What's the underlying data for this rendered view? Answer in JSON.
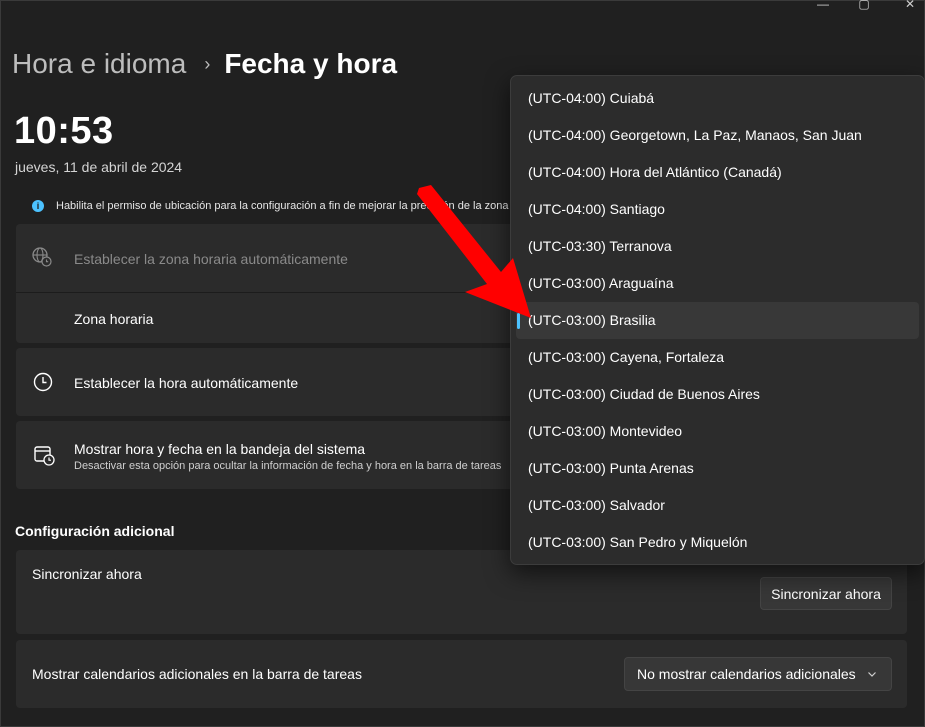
{
  "window": {
    "minimize": "—",
    "maximize": "▢",
    "close": "✕"
  },
  "breadcrumb": {
    "parent": "Hora e idioma",
    "separator": "›",
    "current": "Fecha y hora"
  },
  "clock": {
    "time": "10:53",
    "date": "jueves, 11 de abril de 2024"
  },
  "info_bar": {
    "icon": "info-icon",
    "text": "Habilita el permiso de ubicación para la configuración a fin de mejorar la precisión de la zona"
  },
  "settings": {
    "auto_timezone": {
      "label": "Establecer la zona horaria automáticamente",
      "icon": "globe-clock-icon",
      "disabled": true
    },
    "timezone": {
      "label": "Zona horaria"
    },
    "auto_time": {
      "label": "Establecer la hora automáticamente",
      "icon": "clock-icon"
    },
    "tray": {
      "label": "Mostrar hora y fecha en la bandeja del sistema",
      "description": "Desactivar esta opción para ocultar la información de fecha y hora en la barra de tareas",
      "icon": "calendar-clock-icon"
    }
  },
  "additional": {
    "title": "Configuración adicional",
    "sync": {
      "label": "Sincronizar ahora",
      "button": "Sincronizar ahora"
    },
    "calendars": {
      "label": "Mostrar calendarios adicionales en la barra de tareas",
      "value": "No mostrar calendarios adicionales"
    }
  },
  "timezone_dropdown": {
    "selected_index": 6,
    "accent": "#4cc2ff",
    "items": [
      "(UTC-04:00) Cuiabá",
      "(UTC-04:00) Georgetown, La Paz, Manaos, San Juan",
      "(UTC-04:00) Hora del Atlántico (Canadá)",
      "(UTC-04:00) Santiago",
      "(UTC-03:30) Terranova",
      "(UTC-03:00) Araguaína",
      "(UTC-03:00) Brasilia",
      "(UTC-03:00) Cayena, Fortaleza",
      "(UTC-03:00) Ciudad de Buenos Aires",
      "(UTC-03:00) Montevideo",
      "(UTC-03:00) Punta Arenas",
      "(UTC-03:00) Salvador",
      "(UTC-03:00) San Pedro y Miquelón"
    ]
  },
  "annotation": {
    "color": "#ff0000",
    "icon": "red-arrow-annotation"
  }
}
